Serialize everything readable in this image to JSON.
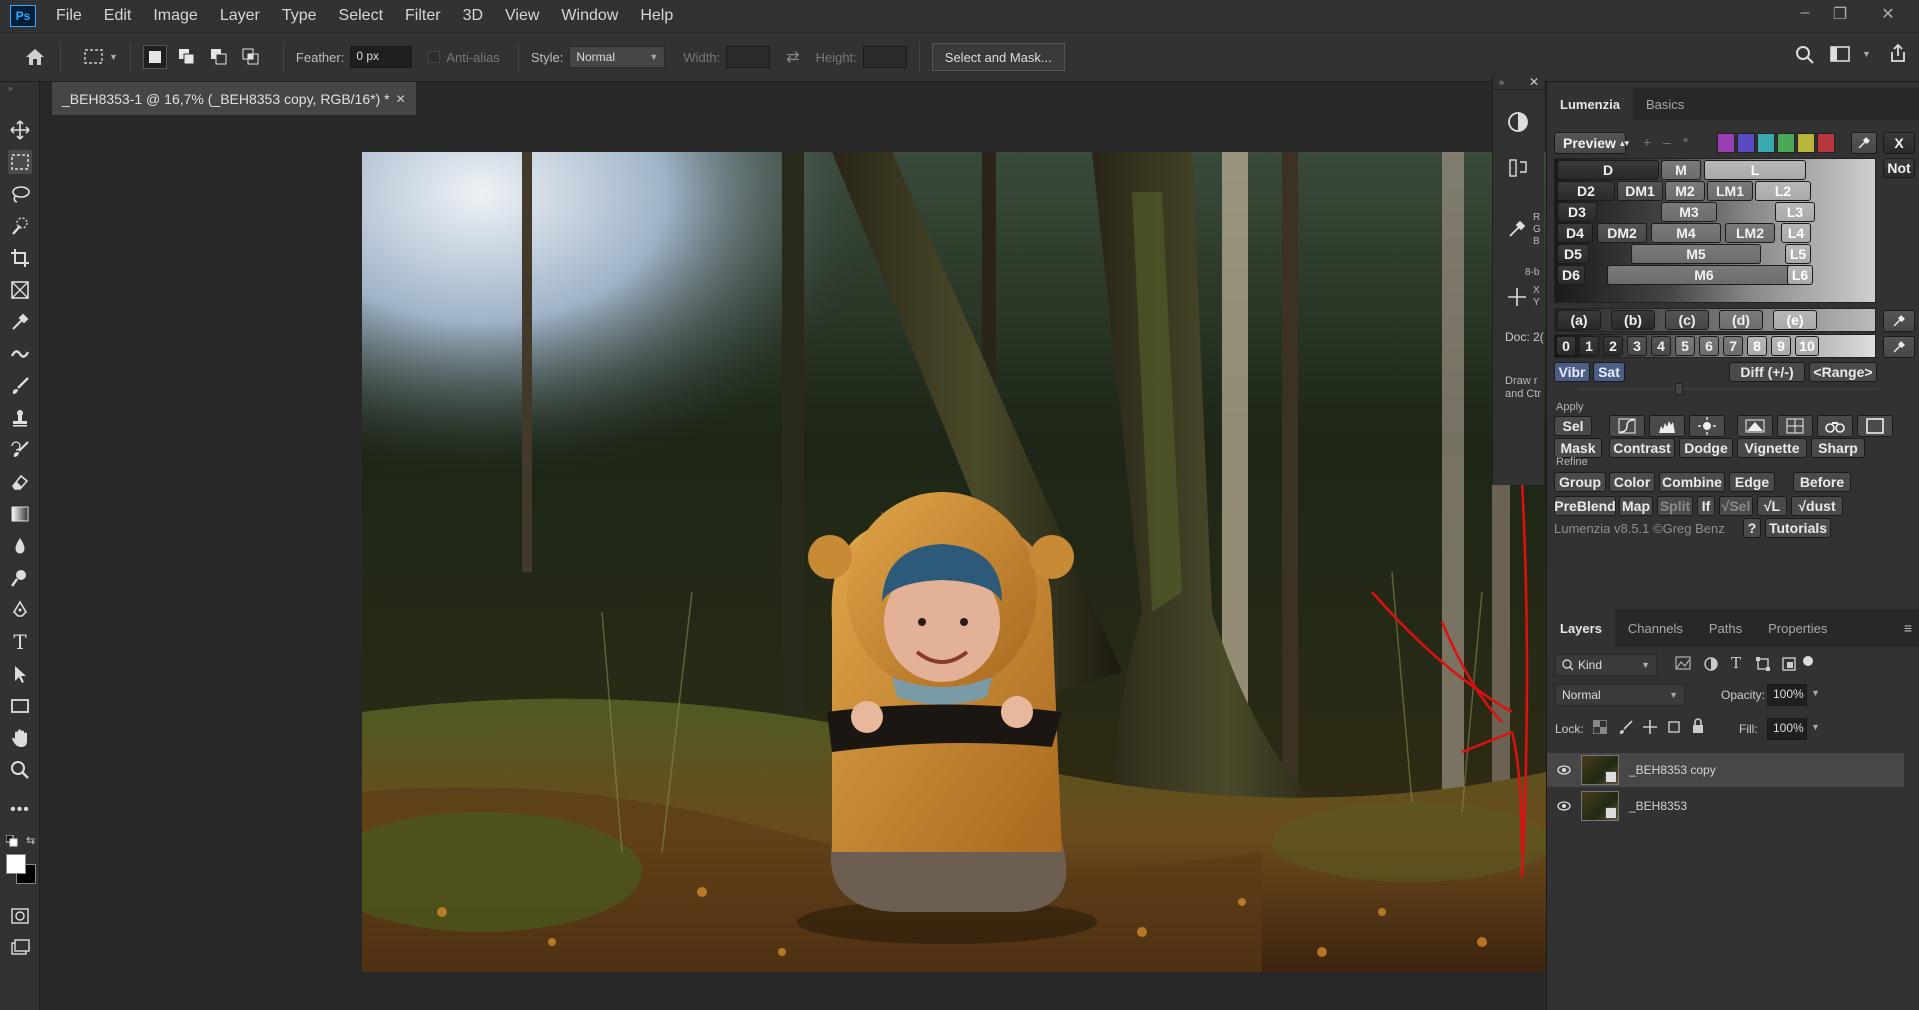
{
  "app": {
    "logo": "Ps"
  },
  "menu": [
    "File",
    "Edit",
    "Image",
    "Layer",
    "Type",
    "Select",
    "Filter",
    "3D",
    "View",
    "Window",
    "Help"
  ],
  "window_controls": {
    "minimize": "–",
    "restore": "❐",
    "close": "✕"
  },
  "options": {
    "feather_label": "Feather:",
    "feather_value": "0 px",
    "antialias_label": "Anti-alias",
    "style_label": "Style:",
    "style_value": "Normal",
    "width_label": "Width:",
    "height_label": "Height:",
    "select_mask": "Select and Mask..."
  },
  "document": {
    "tab_title": "_BEH8353-1 @ 16,7% (_BEH8353 copy, RGB/16*) *",
    "close": "✕"
  },
  "mini_panel": {
    "rgb": [
      "R",
      "G",
      "B"
    ],
    "bit": "8-b",
    "xy": [
      "X",
      "Y"
    ],
    "doc": "Doc: 2(",
    "draw_hint_1": "Draw r",
    "draw_hint_2": "and Ctr"
  },
  "lumenzia": {
    "tabs": [
      "Lumenzia",
      "Basics"
    ],
    "preview": "Preview",
    "close_x": "X",
    "not": "Not",
    "swatches": [
      "#9b3fb5",
      "#5a4bc4",
      "#3ba9b0",
      "#4aa957",
      "#b9b53a",
      "#b8363d"
    ],
    "row1": [
      "D",
      "M",
      "L"
    ],
    "row2": [
      "D2",
      "DM1",
      "M2",
      "LM1",
      "L2"
    ],
    "row3": [
      "D3",
      "M3",
      "L3"
    ],
    "row4": [
      "D4",
      "DM2",
      "M4",
      "LM2",
      "L4"
    ],
    "row5": [
      "D5",
      "M5",
      "L5"
    ],
    "row6": [
      "D6",
      "M6",
      "L6"
    ],
    "zones": [
      "(a)",
      "(b)",
      "(c)",
      "(d)",
      "(e)"
    ],
    "numbers": [
      "0",
      "1",
      "2",
      "3",
      "4",
      "5",
      "6",
      "7",
      "8",
      "9",
      "10"
    ],
    "vibr": "Vibr",
    "sat": "Sat",
    "diff": "Diff (+/-)",
    "range": "<Range>",
    "apply_label": "Apply",
    "sel": "Sel",
    "mask": "Mask",
    "contrast": "Contrast",
    "dodge": "Dodge",
    "vignette": "Vignette",
    "sharp": "Sharp",
    "refine_label": "Refine",
    "group": "Group",
    "color": "Color",
    "combine": "Combine",
    "edge": "Edge",
    "before": "Before",
    "preblend": "PreBlend",
    "map": "Map",
    "split": "Split",
    "if": "If",
    "vsel": "√Sel",
    "vl": "√L",
    "vdust": "√dust",
    "version": "Lumenzia v8.5.1 ©Greg Benz",
    "help": "?",
    "tutorials": "Tutorials"
  },
  "layers_panel": {
    "tabs": [
      "Layers",
      "Channels",
      "Paths",
      "Properties"
    ],
    "kind": "Kind",
    "blend_mode": "Normal",
    "opacity_label": "Opacity:",
    "opacity_value": "100%",
    "lock_label": "Lock:",
    "fill_label": "Fill:",
    "fill_value": "100%",
    "layers": [
      {
        "name": "_BEH8353 copy",
        "selected": true
      },
      {
        "name": "_BEH8353",
        "selected": false
      }
    ]
  },
  "colors": {
    "accent": "#31a8ff",
    "annotation": "#e01010"
  }
}
